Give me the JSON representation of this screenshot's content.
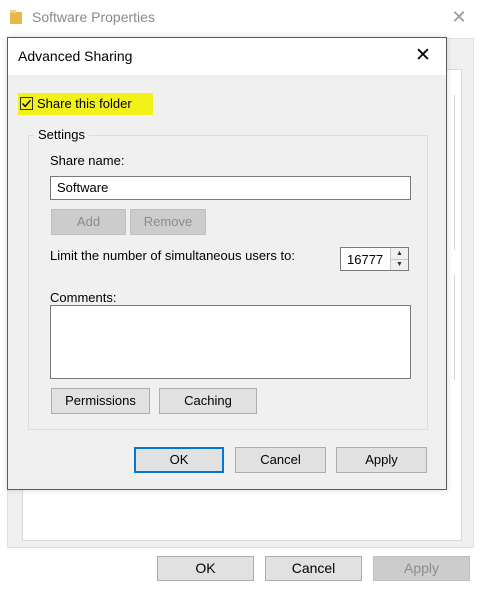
{
  "background_window": {
    "title": "Software Properties",
    "buttons": {
      "ok": "OK",
      "cancel": "Cancel",
      "apply": "Apply"
    }
  },
  "dialog": {
    "title": "Advanced Sharing",
    "share_checkbox": {
      "label": "Share this folder",
      "checked": true,
      "highlight_color": "#f2f21a"
    },
    "settings": {
      "group_label": "Settings",
      "share_name_label": "Share name:",
      "share_name_value": "Software",
      "add_label": "Add",
      "remove_label": "Remove",
      "limit_label": "Limit the number of simultaneous users to:",
      "limit_value": "16777",
      "comments_label": "Comments:",
      "comments_value": "",
      "permissions_label": "Permissions",
      "caching_label": "Caching"
    },
    "buttons": {
      "ok": "OK",
      "cancel": "Cancel",
      "apply": "Apply"
    }
  },
  "icons": {
    "folder": "folder-icon",
    "close": "close-icon",
    "check": "checkmark-icon",
    "spin_up": "spin-up-arrow-icon",
    "spin_down": "spin-down-arrow-icon"
  },
  "colors": {
    "accent": "#0078d7",
    "dialog_bg": "#f0f0f0"
  }
}
